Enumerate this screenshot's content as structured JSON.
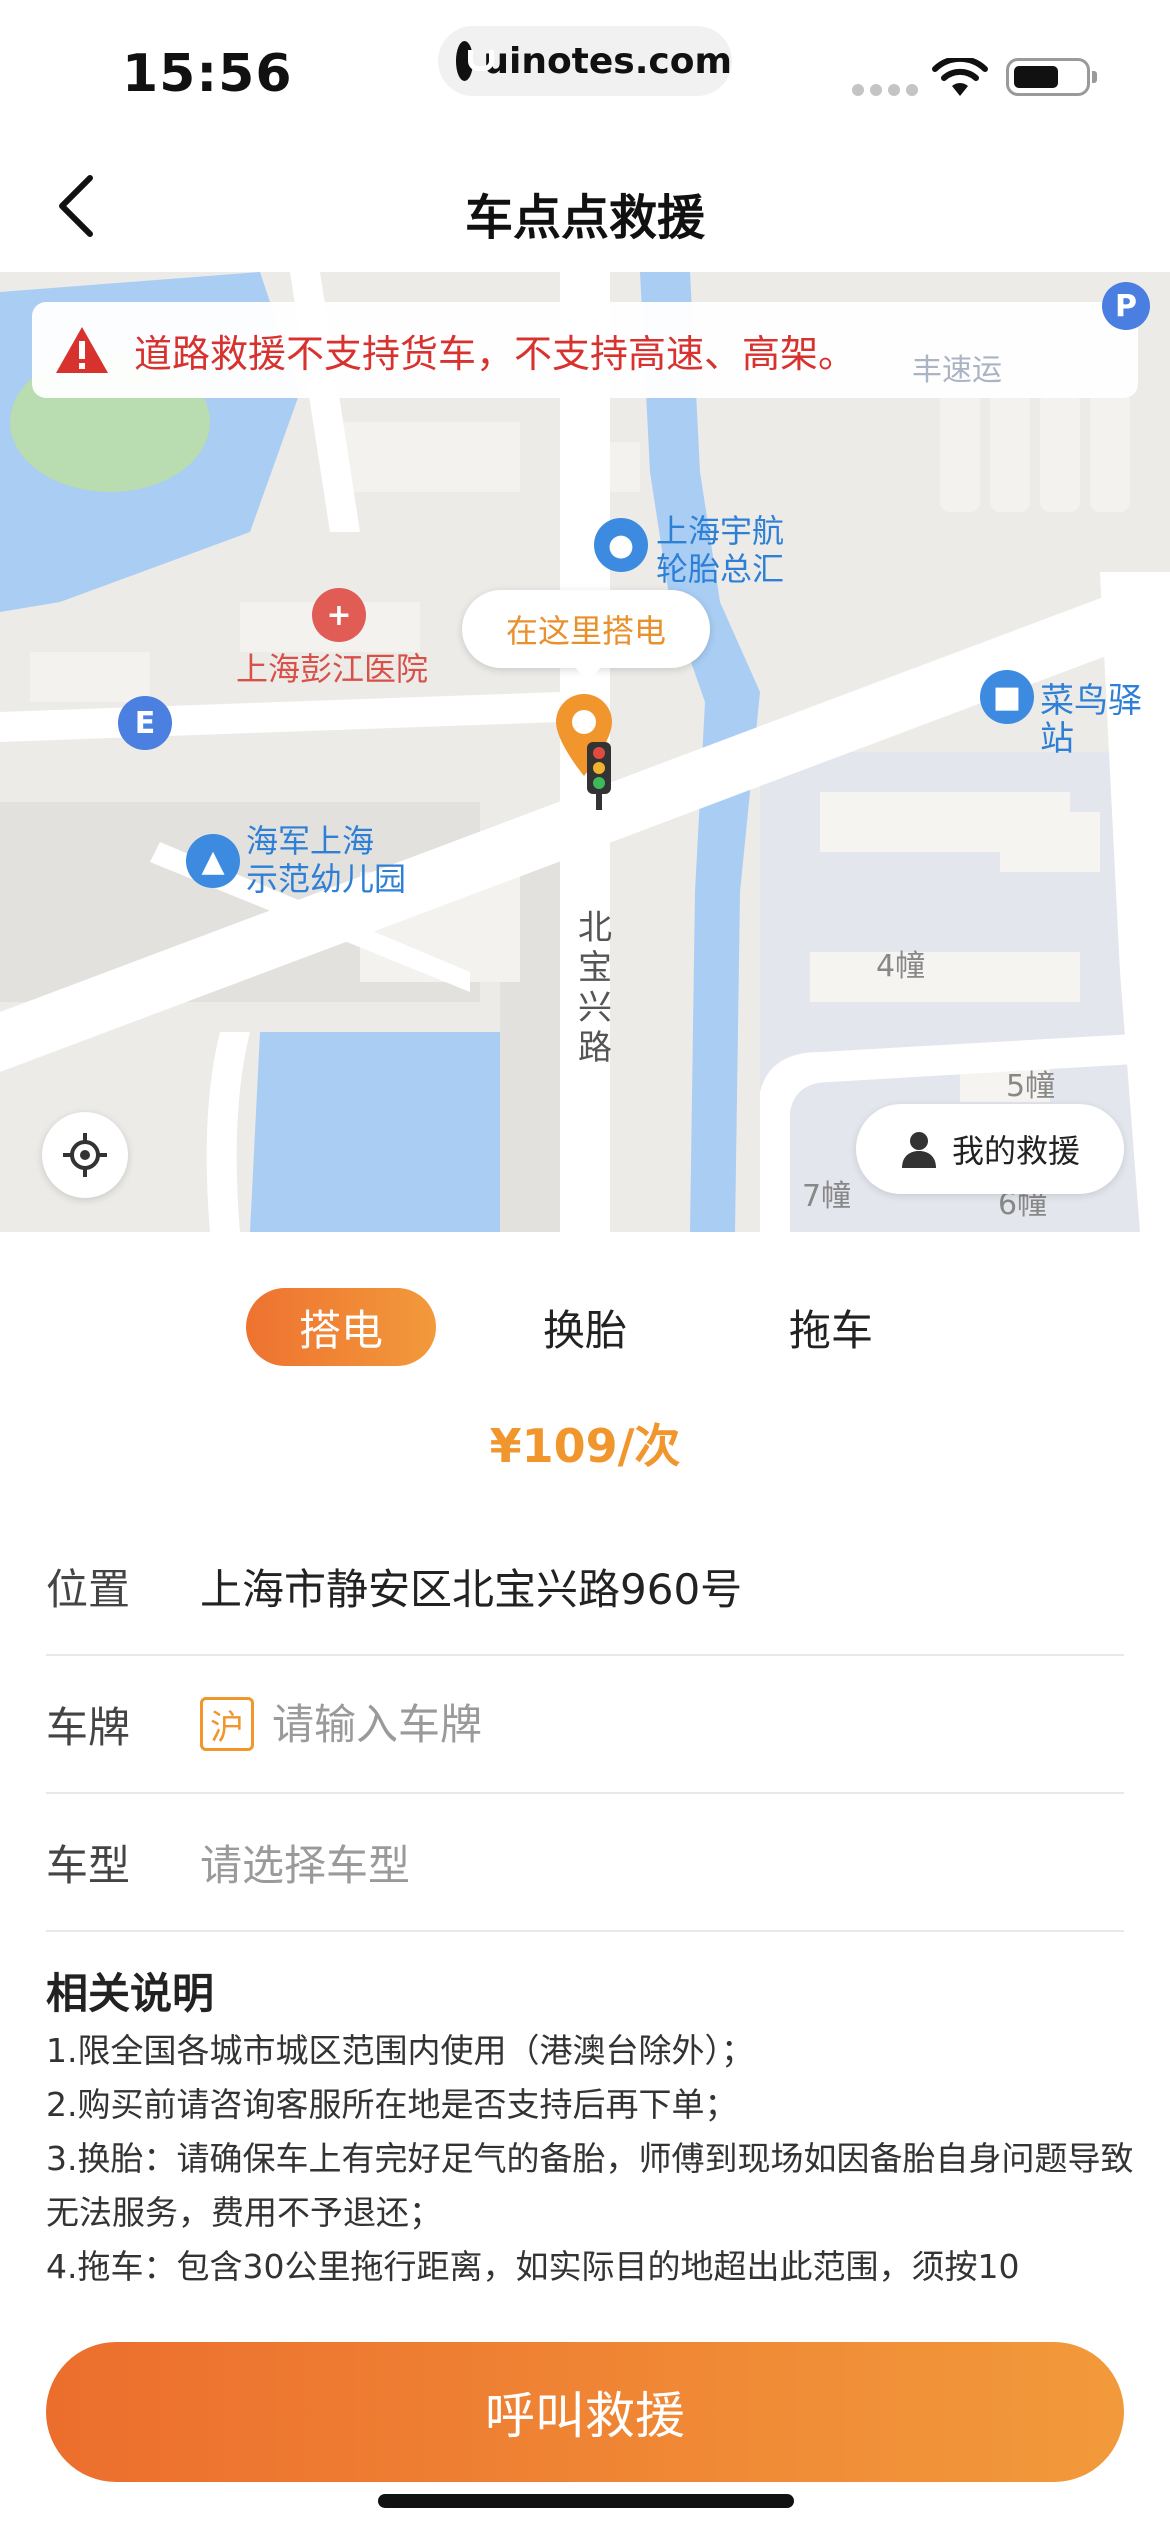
{
  "status_bar": {
    "time": "15:56",
    "url": "uinotes.com"
  },
  "nav": {
    "title": "车点点救援"
  },
  "map": {
    "notice": "道路救援不支持货车，不支持高速、高架。",
    "callout": "在这里搭电",
    "labels": {
      "hospital": "上海彭江医院",
      "tire_shop_line1": "上海宇航",
      "tire_shop_line2": "轮胎总汇",
      "kindergarten_line1": "海军上海",
      "kindergarten_line2": "示范幼儿园",
      "courier": "菜鸟驿站",
      "road": "北宝兴路",
      "building_4": "4幢",
      "building_5": "5幢",
      "building_6": "6幢",
      "building_7": "7幢",
      "express": "丰速运",
      "parking": "P"
    },
    "my_rescue_label": "我的救援"
  },
  "panel": {
    "tabs": [
      {
        "label": "搭电",
        "active": true
      },
      {
        "label": "换胎",
        "active": false
      },
      {
        "label": "拖车",
        "active": false
      }
    ],
    "price": "¥109/次",
    "location": {
      "label": "位置",
      "value": "上海市静安区北宝兴路960号"
    },
    "plate": {
      "label": "车牌",
      "prefix": "沪",
      "placeholder": "请输入车牌"
    },
    "car_type": {
      "label": "车型",
      "placeholder": "请选择车型"
    },
    "notes_title": "相关说明",
    "notes": [
      "1.限全国各城市城区范围内使用（港澳台除外）；",
      "2.购买前请咨询客服所在地是否支持后再下单；",
      "3.换胎：请确保车上有完好足气的备胎，师傅到现场如因备胎自身问题导致无法服务，费用不予退还；",
      "4.拖车：包含30公里拖行距离，如实际目的地超出此范围，须按10"
    ],
    "call_button": "呼叫救援"
  },
  "colors": {
    "accent": "#f0962d",
    "gradient_start": "#ec6e2d",
    "gradient_end": "#f29a3b",
    "warning": "#d8322f",
    "poi_blue": "#2e7fd6"
  }
}
